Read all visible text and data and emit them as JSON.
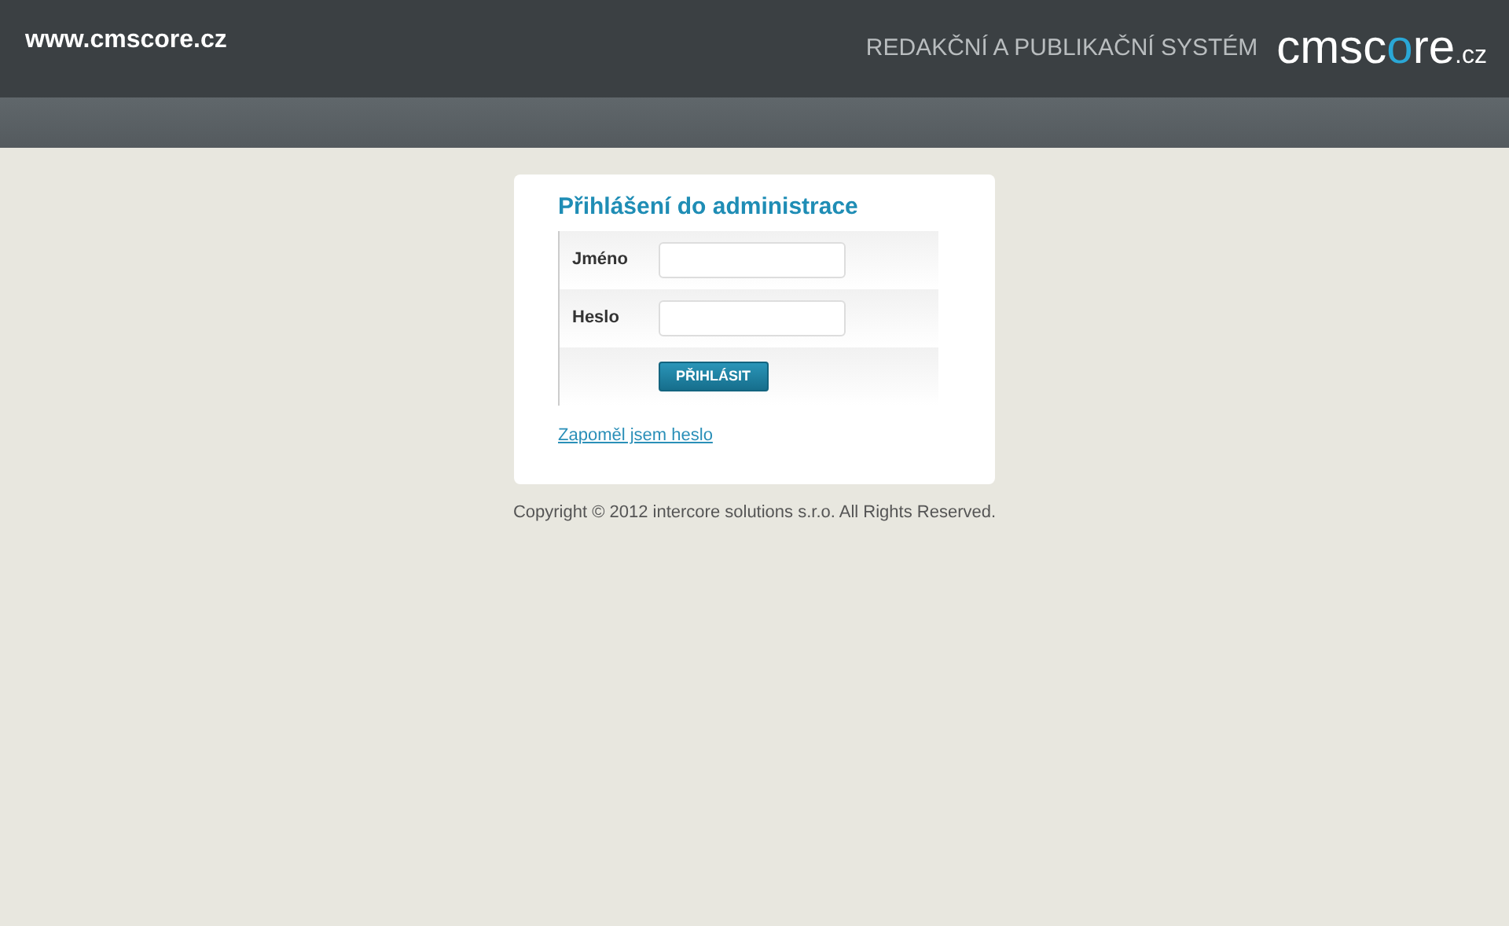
{
  "header": {
    "site": "www.cmscore.cz",
    "tagline": "REDAKČNÍ A PUBLIKAČNÍ SYSTÉM",
    "logo_parts": [
      {
        "text": "cmsc",
        "accent": false
      },
      {
        "text": "o",
        "accent": true
      },
      {
        "text": "re",
        "accent": false
      },
      {
        "text": ".cz",
        "accent": false,
        "kind": "suffix"
      }
    ]
  },
  "login": {
    "title": "Přihlášení do administrace",
    "fields": [
      {
        "label": "Jméno"
      },
      {
        "label": "Heslo"
      }
    ],
    "button": "PŘIHLÁSIT",
    "forgot_link": "Zapoměl jsem heslo"
  },
  "footer": "Copyright © 2012 intercore solutions s.r.o. All Rights Reserved."
}
